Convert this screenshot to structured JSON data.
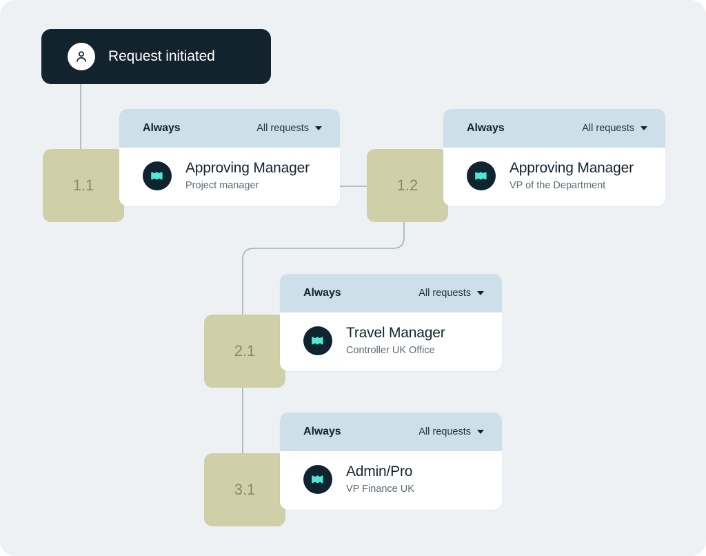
{
  "theme": {
    "background": "#eef1f4",
    "trigger_card_bg": "#12232e",
    "index_block_bg": "#cfd0a8",
    "index_text": "#8a8a5f",
    "step_header_bg": "#cde0ea",
    "step_body_bg": "#ffffff",
    "avatar_bg": "#0f2430",
    "avatar_glyph": "#4fe8d0",
    "connector_line": "#9fb3b0",
    "title_text": "#16232d",
    "subtitle_text": "#5c6b73"
  },
  "trigger": {
    "label": "Request initiated",
    "icon": "person-icon"
  },
  "steps": [
    {
      "index": "1.1",
      "condition_label": "Always",
      "filter_label": "All requests",
      "filter_icon": "chevron-down-icon",
      "approver_role": "Approving Manager",
      "approver_subtitle": "Project manager",
      "avatar_icon": "brand-zigzag-icon"
    },
    {
      "index": "1.2",
      "condition_label": "Always",
      "filter_label": "All requests",
      "filter_icon": "chevron-down-icon",
      "approver_role": "Approving Manager",
      "approver_subtitle": "VP of the Department",
      "avatar_icon": "brand-zigzag-icon"
    },
    {
      "index": "2.1",
      "condition_label": "Always",
      "filter_label": "All requests",
      "filter_icon": "chevron-down-icon",
      "approver_role": "Travel Manager",
      "approver_subtitle": "Controller UK Office",
      "avatar_icon": "brand-zigzag-icon"
    },
    {
      "index": "3.1",
      "condition_label": "Always",
      "filter_label": "All requests",
      "filter_icon": "chevron-down-icon",
      "approver_role": "Admin/Pro",
      "approver_subtitle": "VP Finance UK",
      "avatar_icon": "brand-zigzag-icon"
    }
  ]
}
